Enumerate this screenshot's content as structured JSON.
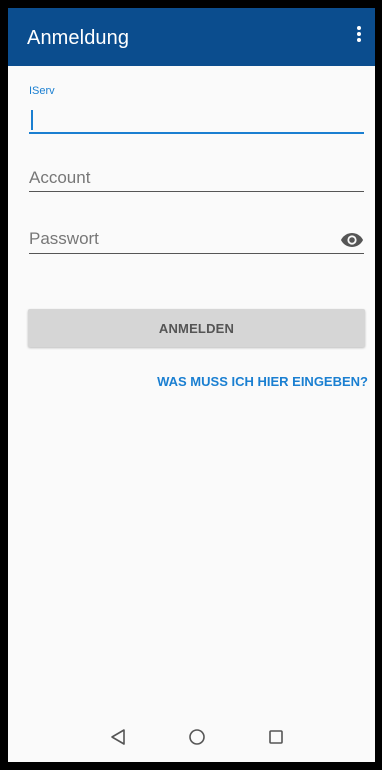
{
  "appbar": {
    "title": "Anmeldung",
    "menu_icon": "more-vert-icon",
    "background": "#0b4d8e"
  },
  "form": {
    "server": {
      "label": "IServ",
      "value": ""
    },
    "account": {
      "placeholder": "Account",
      "value": ""
    },
    "password": {
      "placeholder": "Passwort",
      "value": "",
      "toggle_icon": "eye-icon"
    },
    "login_label": "ANMELDEN",
    "help_label": "WAS MUSS ICH HIER EINGEBEN?"
  },
  "navigation": {
    "back_icon": "back-triangle-icon",
    "home_icon": "home-circle-icon",
    "recents_icon": "recents-square-icon"
  },
  "colors": {
    "accent": "#1a7fd1",
    "button_bg": "#d6d6d6",
    "page_bg": "#fafafa"
  }
}
